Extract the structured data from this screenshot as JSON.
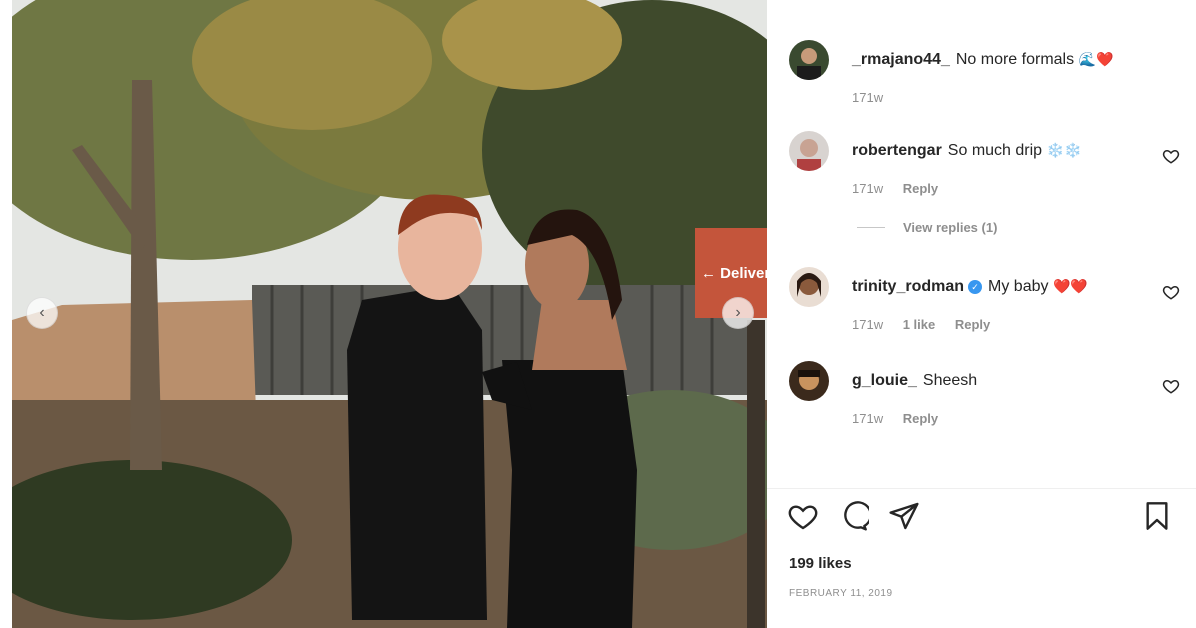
{
  "photo": {
    "sign_text": "← Deliver"
  },
  "comments": [
    {
      "username": "_rmajano44_",
      "text": "No more formals",
      "emoji": "🌊❤️",
      "age": "171w"
    },
    {
      "username": "robertengar",
      "text": "So much drip",
      "emoji": "❄️❄️",
      "age": "171w",
      "reply_label": "Reply",
      "view_replies": "View replies (1)"
    },
    {
      "username": "trinity_rodman",
      "text": "My baby",
      "emoji": "❤️❤️",
      "age": "171w",
      "likes": "1 like",
      "reply_label": "Reply"
    },
    {
      "username": "g_louie_",
      "text": "Sheesh",
      "age": "171w",
      "reply_label": "Reply"
    }
  ],
  "post": {
    "likes": "199 likes",
    "date": "FEBRUARY 11, 2019"
  },
  "colors": {
    "heart_red": "#ed4956",
    "verified_blue": "#3897f0",
    "snowflake": "#5bb8e8"
  }
}
